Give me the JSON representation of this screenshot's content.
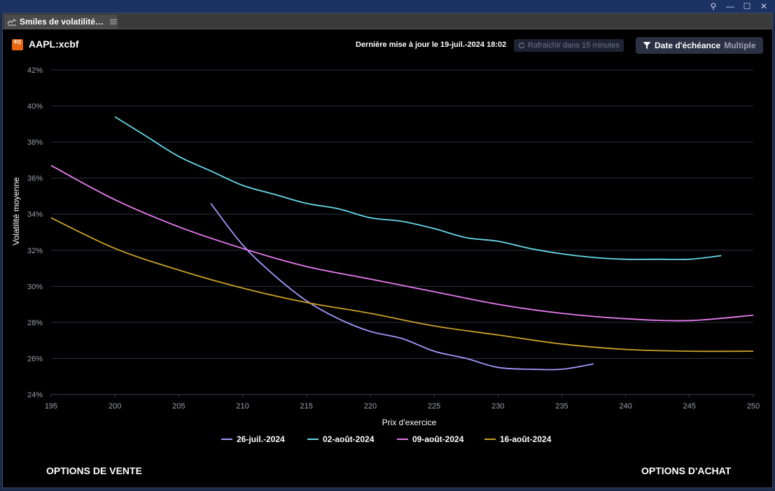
{
  "window": {
    "tab_title": "Smiles de volatilité…",
    "pin_glyph": "⚲",
    "minimize_glyph": "—",
    "maximize_glyph": "☐",
    "close_glyph": "✕"
  },
  "header": {
    "logo_text": "EQ",
    "symbol": "AAPL:xcbf",
    "last_updated": "Dernière mise à jour le 19-juil.-2024 18:02",
    "refresh_label": "Rafraichir dans 15 minutes",
    "filter_label": "Date d'échéance",
    "filter_value": "Multiple"
  },
  "footer": {
    "puts_label": "OPTIONS DE VENTE",
    "calls_label": "OPTIONS D'ACHAT"
  },
  "chart_data": {
    "type": "line",
    "title": "",
    "xlabel": "Prix d'exercice",
    "ylabel": "Volatilité moyenne",
    "xlim": [
      195,
      250
    ],
    "ylim": [
      24,
      42
    ],
    "x_ticks": [
      195,
      200,
      205,
      210,
      215,
      220,
      225,
      230,
      235,
      240,
      245,
      250
    ],
    "y_ticks": [
      24,
      26,
      28,
      30,
      32,
      34,
      36,
      38,
      40,
      42
    ],
    "y_tick_suffix": "%",
    "grid": true,
    "legend_position": "bottom",
    "series": [
      {
        "name": "26-juil.-2024",
        "color": "#a29bfe",
        "x": [
          207.5,
          210,
          212.5,
          215,
          217.5,
          220,
          222.5,
          225,
          227.5,
          230,
          232.5,
          235,
          237.5
        ],
        "y": [
          34.6,
          32.3,
          30.6,
          29.2,
          28.2,
          27.5,
          27.1,
          26.4,
          26.0,
          25.5,
          25.4,
          25.4,
          25.7
        ]
      },
      {
        "name": "02-août-2024",
        "color": "#66d9e8",
        "x": [
          200,
          202.5,
          205,
          207.5,
          210,
          212.5,
          215,
          217.5,
          220,
          222.5,
          225,
          227.5,
          230,
          232.5,
          235,
          237.5,
          240,
          242.5,
          245,
          247.5
        ],
        "y": [
          39.4,
          38.3,
          37.2,
          36.4,
          35.6,
          35.1,
          34.6,
          34.3,
          33.8,
          33.6,
          33.2,
          32.7,
          32.5,
          32.1,
          31.8,
          31.6,
          31.5,
          31.5,
          31.5,
          31.7
        ]
      },
      {
        "name": "09-août-2024",
        "color": "#e87cf0",
        "x": [
          195,
          200,
          205,
          210,
          215,
          220,
          225,
          230,
          235,
          240,
          245,
          250
        ],
        "y": [
          36.7,
          34.8,
          33.3,
          32.1,
          31.1,
          30.4,
          29.7,
          29.0,
          28.5,
          28.2,
          28.1,
          28.4
        ]
      },
      {
        "name": "16-août-2024",
        "color": "#c9a227",
        "x": [
          195,
          200,
          205,
          210,
          215,
          220,
          225,
          230,
          235,
          240,
          245,
          250
        ],
        "y": [
          33.8,
          32.1,
          30.9,
          29.9,
          29.1,
          28.5,
          27.8,
          27.3,
          26.8,
          26.5,
          26.4,
          26.4
        ]
      }
    ]
  }
}
